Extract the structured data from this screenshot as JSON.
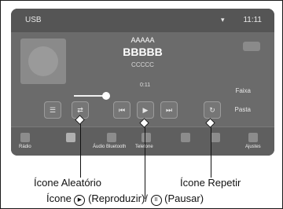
{
  "status": {
    "left": "USB",
    "right": "11:11"
  },
  "track": {
    "line1": "AAAAA",
    "line2": "BBBBB",
    "line3": "CCCCC",
    "time": "0:11"
  },
  "side_labels": {
    "faixa": "Faixa",
    "pasta": "Pasta"
  },
  "tabs": [
    {
      "label": "Rádio"
    },
    {
      "label": ""
    },
    {
      "label": "Áudio Bluetooth"
    },
    {
      "label": "Telefone"
    },
    {
      "label": ""
    },
    {
      "label": ""
    },
    {
      "label": "Ajustes"
    }
  ],
  "callouts": {
    "aleatorio": "Ícone Aleatório",
    "repetir": "Ícone Repetir",
    "play_pause_prefix": "Ícone",
    "play_symbol": "▶",
    "play_text": "(Reproduzir)/",
    "pause_symbol": "II",
    "pause_text": "(Pausar)"
  },
  "icons": [
    "shuffle-icon",
    "previous-icon",
    "play-icon",
    "next-icon",
    "repeat-icon"
  ],
  "colors": {
    "screen": "#6b6b6b",
    "accent": "#ffffff"
  }
}
